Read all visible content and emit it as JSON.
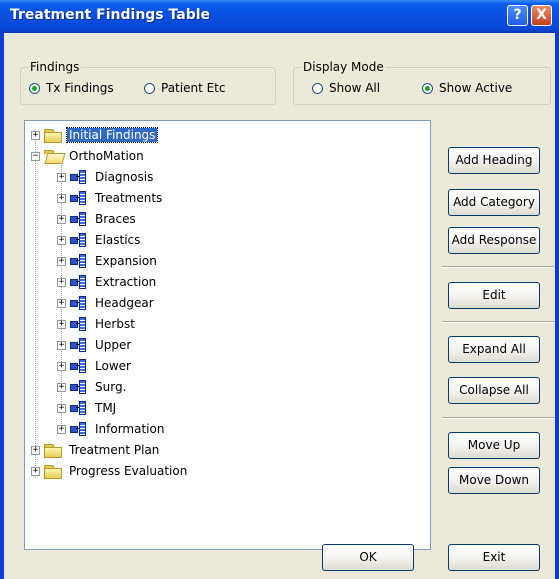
{
  "window": {
    "title": "Treatment Findings Table",
    "help_label": "?",
    "close_label": "X"
  },
  "findings_group": {
    "legend": "Findings",
    "options": [
      "Tx Findings",
      "Patient Etc"
    ],
    "selected": "Tx Findings"
  },
  "display_group": {
    "legend": "Display Mode",
    "options": [
      "Show All",
      "Show Active"
    ],
    "selected": "Show Active"
  },
  "tree": {
    "root1": "Initial Findings",
    "root2": "OrthoMation",
    "children": [
      "Diagnosis",
      "Treatments",
      "Braces",
      "Elastics",
      "Expansion",
      "Extraction",
      "Headgear",
      "Herbst",
      "Upper",
      "Lower",
      "Surg.",
      "TMJ",
      "Information"
    ],
    "root3": "Treatment Plan",
    "root4": "Progress Evaluation",
    "expand_symbol": "+",
    "collapse_symbol": "−"
  },
  "buttons": {
    "add_heading": "Add Heading",
    "add_category": "Add Category",
    "add_response": "Add Response",
    "edit": "Edit",
    "expand_all": "Expand All",
    "collapse_all": "Collapse All",
    "move_up": "Move Up",
    "move_down": "Move Down",
    "ok": "OK",
    "exit": "Exit"
  }
}
